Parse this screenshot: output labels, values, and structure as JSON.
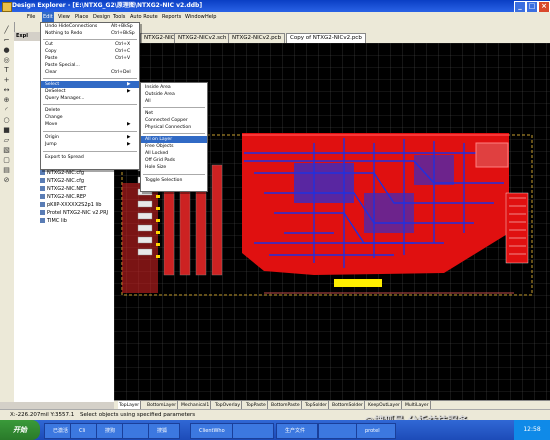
{
  "window": {
    "title": "Design Explorer - [E:\\NTXG_G2\\原理图\\NTXG2-NIC v2.ddb]",
    "minimize": "_",
    "maximize": "□",
    "close": "×"
  },
  "menubar": {
    "items": [
      "File",
      "Edit",
      "View",
      "Place",
      "Design",
      "Tools",
      "Auto Route",
      "Reports",
      "Window",
      "Help"
    ]
  },
  "explorer": {
    "title": "Expl",
    "tree": [
      "NTXG2-NIC.cfg",
      "NTXG2-NIC.cfg",
      "NTXG2-NIC.NET",
      "NTXG2-NIC.REP",
      "pKIIP-XXXXX2S2p1 lib",
      "Protel NTXG2-NIC v2.PRJ",
      "TIMC lib"
    ]
  },
  "doctabs": [
    "NTXG2-NICv2.ddb",
    "NTXG2-NICv2.sch",
    "NTXG2-NICv2.pcb",
    "Copy of NTXG2-NICv2.pcb"
  ],
  "edit_menu": [
    {
      "label": "Undo HideConnections",
      "key": "Alt+BkSp"
    },
    {
      "label": "Nothing to Redo",
      "key": "Ctrl+BkSp"
    },
    {
      "label": "Cut",
      "key": "Ctrl+X"
    },
    {
      "label": "Copy",
      "key": "Ctrl+C"
    },
    {
      "label": "Paste",
      "key": "Ctrl+V"
    },
    {
      "label": "Paste Special...",
      "key": ""
    },
    {
      "label": "Clear",
      "key": "Ctrl+Del"
    },
    {
      "label": "Select",
      "key": "▶"
    },
    {
      "label": "DeSelect",
      "key": "▶"
    },
    {
      "label": "Query Manager...",
      "key": ""
    },
    {
      "label": "Delete",
      "key": ""
    },
    {
      "label": "Change",
      "key": ""
    },
    {
      "label": "Move",
      "key": "▶"
    },
    {
      "label": "Origin",
      "key": "▶"
    },
    {
      "label": "Jump",
      "key": "▶"
    },
    {
      "label": "Export to Spread",
      "key": ""
    }
  ],
  "select_menu": [
    "Inside Area",
    "Outside Area",
    "All",
    "Net",
    "Connected Copper",
    "Physical Connection",
    "All on Layer",
    "Free Objects",
    "All Locked",
    "Off Grid Pads",
    "Hole Size",
    "Toggle Selection"
  ],
  "layer_tabs": [
    "TopLayer",
    "BottomLayer",
    "Mechanical1",
    "TopOverlay",
    "TopPaste",
    "BottomPaste",
    "TopSolder",
    "BottomSolder",
    "KeepOutLayer",
    "MultiLayer"
  ],
  "status": {
    "coords": "X:-226.207mil Y:3557.1",
    "message": "Select objects using specified parameters"
  },
  "taskbar": {
    "start": "开始",
    "tasks": [
      "已激活",
      "Cli",
      "搜狗",
      "",
      "搜狐",
      "ClientWho",
      "",
      "生产文件",
      "",
      "protel"
    ],
    "clock": "12:58"
  },
  "watermark": "@搜狐号 分析益技服务",
  "colors": {
    "titlebar": "#0a3fc4",
    "pcb_red": "#e01010",
    "pcb_blue": "#2030e0",
    "grid": "#4a4a4a"
  }
}
